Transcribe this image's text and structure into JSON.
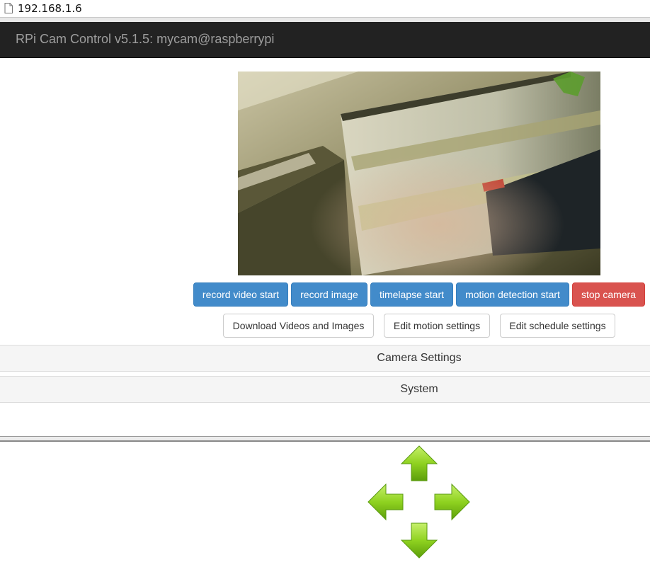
{
  "browser": {
    "url": "192.168.1.6"
  },
  "navbar": {
    "title": "RPi Cam Control v5.1.5: mycam@raspberrypi"
  },
  "controls": {
    "record_video": "record video start",
    "record_image": "record image",
    "timelapse": "timelapse start",
    "motion_detection": "motion detection start",
    "stop_camera": "stop camera"
  },
  "links": {
    "download": "Download Videos and Images",
    "motion_settings": "Edit motion settings",
    "schedule_settings": "Edit schedule settings"
  },
  "panels": {
    "camera_settings": "Camera Settings",
    "system": "System"
  },
  "pan_tilt": [
    "up-arrow-icon",
    "left-arrow-icon",
    "right-arrow-icon",
    "down-arrow-icon"
  ],
  "colors": {
    "primary": "#428bca",
    "danger": "#d9534f",
    "navbar": "#222222",
    "arrow": "#7cc41a"
  }
}
